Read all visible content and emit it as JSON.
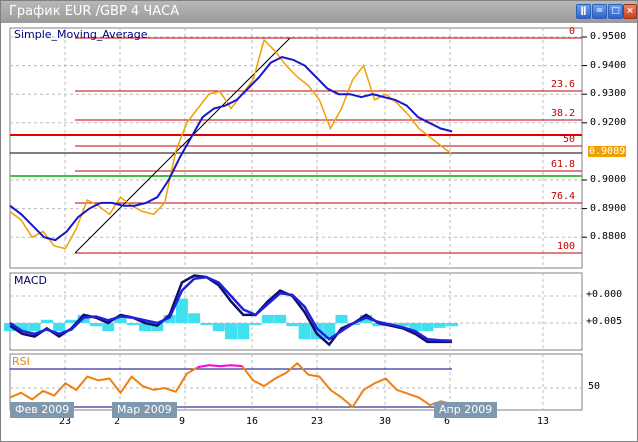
{
  "window": {
    "title": "График EUR /GBP  4 ЧАСА",
    "buttons": [
      "ǁ",
      "=",
      "□",
      "×"
    ]
  },
  "main": {
    "indicator_label": "Simple_Moving_Average",
    "current_price": "0.9089",
    "price_ticks": [
      "0.9500",
      "0.9400",
      "0.9300",
      "0.9200",
      "0.9000",
      "0.8900",
      "0.8800"
    ],
    "fib_levels": [
      "0",
      "23.6",
      "38.2",
      "50",
      "61.8",
      "76.4",
      "100"
    ]
  },
  "macd": {
    "label": "MACD",
    "ticks": [
      "+0.005",
      "+0.000"
    ]
  },
  "rsi": {
    "label": "RSI",
    "ticks": [
      "50"
    ]
  },
  "time_axis": {
    "ticks": [
      "23",
      "2",
      "9",
      "16",
      "23",
      "30",
      "6",
      "13"
    ],
    "month_tags": [
      "Фев 2009",
      "Мар 2009",
      "Апр 2009"
    ]
  },
  "colors": {
    "price": "#f0a000",
    "sma": "#1818c8",
    "fib": "#c00000",
    "support": "#40c040",
    "macd_main": "#10106a",
    "macd_signal": "#2020e0",
    "macd_hist": "#40e0f0",
    "rsi": "#f08010",
    "rsi_over": "#ff00ff"
  },
  "chart_data": {
    "type": "line",
    "price_range": [
      0.872,
      0.952
    ],
    "price": [
      0.889,
      0.886,
      0.88,
      0.882,
      0.877,
      0.876,
      0.883,
      0.893,
      0.891,
      0.888,
      0.894,
      0.891,
      0.889,
      0.888,
      0.892,
      0.91,
      0.92,
      0.925,
      0.93,
      0.931,
      0.925,
      0.93,
      0.935,
      0.949,
      0.945,
      0.94,
      0.936,
      0.933,
      0.928,
      0.918,
      0.925,
      0.935,
      0.94,
      0.928,
      0.93,
      0.927,
      0.923,
      0.918,
      0.915,
      0.912,
      0.909
    ],
    "sma": [
      0.891,
      0.888,
      0.884,
      0.88,
      0.879,
      0.882,
      0.887,
      0.89,
      0.892,
      0.892,
      0.891,
      0.891,
      0.892,
      0.894,
      0.9,
      0.908,
      0.915,
      0.922,
      0.925,
      0.926,
      0.928,
      0.932,
      0.936,
      0.941,
      0.943,
      0.942,
      0.94,
      0.936,
      0.932,
      0.93,
      0.93,
      0.929,
      0.93,
      0.929,
      0.928,
      0.926,
      0.922,
      0.92,
      0.918,
      0.917
    ],
    "macd_main": [
      -0.0005,
      -0.002,
      -0.0025,
      -0.001,
      -0.0025,
      -0.001,
      0.0015,
      0.001,
      0.0,
      0.0015,
      0.001,
      0.0,
      -0.0005,
      0.0015,
      0.0075,
      0.0088,
      0.0085,
      0.007,
      0.004,
      0.0015,
      0.0015,
      0.004,
      0.006,
      0.005,
      0.002,
      -0.002,
      -0.004,
      -0.001,
      0.0,
      0.0015,
      0.0,
      -0.0005,
      -0.001,
      -0.002,
      -0.0035,
      -0.0035,
      -0.0035
    ],
    "macd_signal": [
      0.0,
      -0.0015,
      -0.002,
      -0.0012,
      -0.002,
      -0.0012,
      0.001,
      0.0012,
      0.0005,
      0.0012,
      0.001,
      0.0005,
      0.0,
      0.001,
      0.006,
      0.0082,
      0.0085,
      0.0075,
      0.005,
      0.0025,
      0.0015,
      0.0035,
      0.0055,
      0.0052,
      0.003,
      -0.001,
      -0.003,
      -0.0015,
      0.0,
      0.001,
      0.0002,
      -0.0003,
      -0.0008,
      -0.0015,
      -0.003,
      -0.0032,
      -0.0033
    ],
    "rsi": [
      40,
      45,
      38,
      47,
      42,
      55,
      48,
      62,
      58,
      60,
      45,
      62,
      52,
      48,
      50,
      46,
      65,
      72,
      74,
      73,
      74,
      73,
      58,
      52,
      60,
      66,
      76,
      64,
      62,
      48,
      40,
      30,
      48,
      55,
      60,
      48,
      44,
      40,
      32,
      36,
      33
    ],
    "rsi_levels": [
      70,
      30
    ]
  }
}
